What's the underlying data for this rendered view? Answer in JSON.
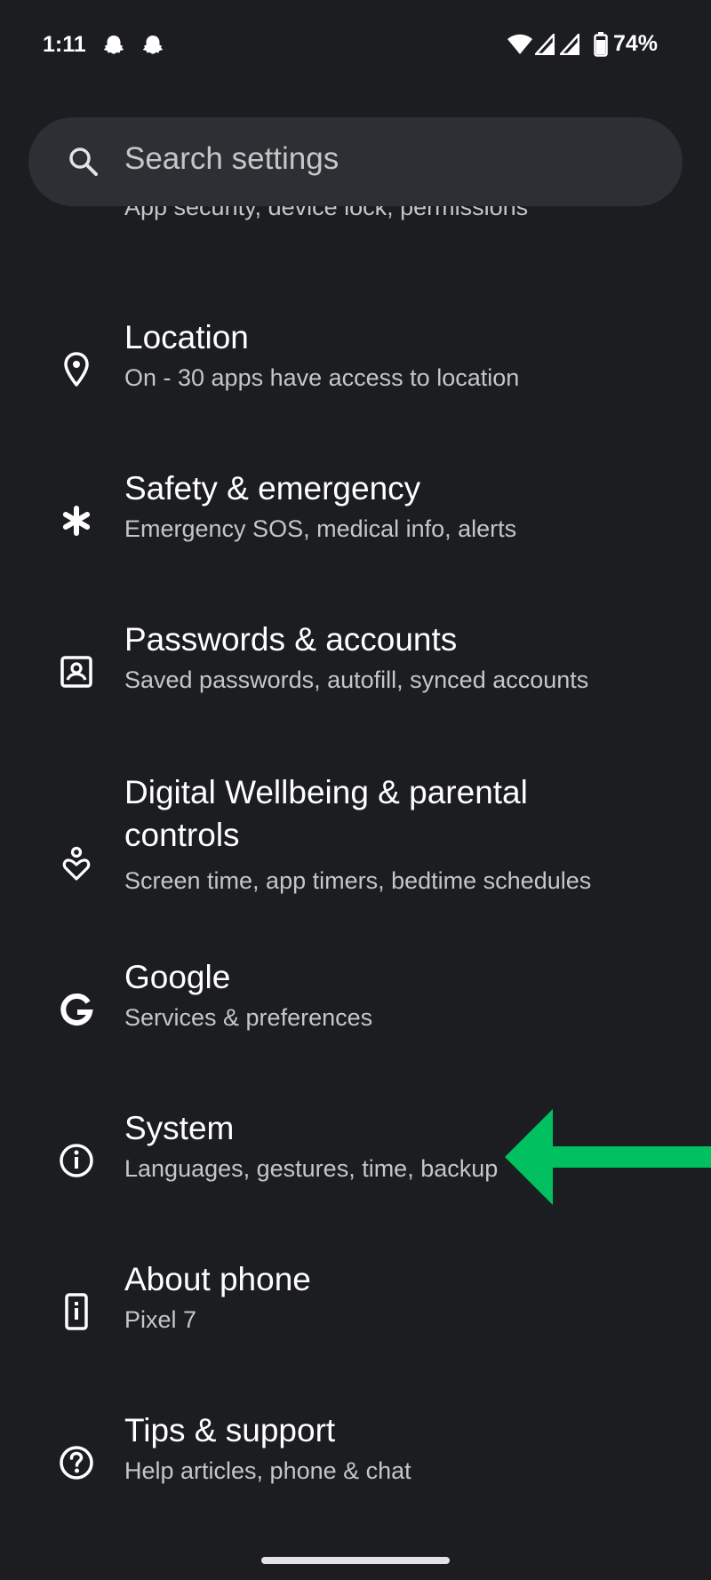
{
  "status_bar": {
    "time": "1:11",
    "notifications": [
      "snapchat-icon",
      "snapchat-icon"
    ],
    "system_icons": [
      "wifi-icon",
      "cell-signal-icon",
      "cell-signal-icon",
      "battery-icon"
    ],
    "battery_percent": "74%"
  },
  "search": {
    "placeholder": "Search settings"
  },
  "partial_item": {
    "subtitle": "App security, device lock, permissions"
  },
  "items": [
    {
      "title": "Location",
      "subtitle": "On - 30 apps have access to location",
      "icon": "location-pin-icon"
    },
    {
      "title": "Safety & emergency",
      "subtitle": "Emergency SOS, medical info, alerts",
      "icon": "asterisk-icon"
    },
    {
      "title": "Passwords & accounts",
      "subtitle": "Saved passwords, autofill, synced accounts",
      "icon": "account-box-icon"
    },
    {
      "title": "Digital Wellbeing & parental",
      "title_line2": "controls",
      "subtitle": "Screen time, app timers, bedtime schedules",
      "icon": "wellbeing-icon"
    },
    {
      "title": "Google",
      "subtitle": "Services & preferences",
      "icon": "google-icon"
    },
    {
      "title": "System",
      "subtitle": "Languages, gestures, time, backup",
      "icon": "info-icon"
    },
    {
      "title": "About phone",
      "subtitle": "Pixel 7",
      "icon": "phone-icon"
    },
    {
      "title": "Tips & support",
      "subtitle": "Help articles, phone & chat",
      "icon": "help-icon"
    }
  ],
  "annotation": {
    "arrow_color": "#00c060",
    "points_to": "System"
  },
  "colors": {
    "background": "#1b1d20",
    "search_bar": "#2c2f33",
    "title": "#ffffff",
    "subtitle": "#c4c7c5"
  }
}
